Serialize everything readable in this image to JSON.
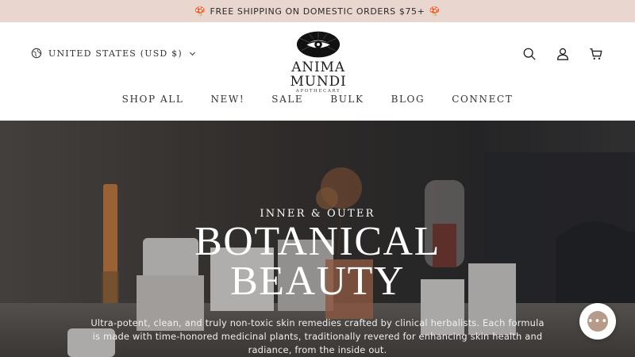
{
  "announcement": {
    "emoji_left": "🍄",
    "text": "FREE SHIPPING ON DOMESTIC ORDERS $75+",
    "emoji_right": "🍄"
  },
  "header": {
    "locale_label": "UNITED STATES (USD $)",
    "logo": {
      "name": "ANIMA MUNDI",
      "subtitle": "APOTHECARY"
    },
    "icons": [
      "search-icon",
      "account-icon",
      "cart-icon"
    ]
  },
  "nav": {
    "items": [
      "SHOP ALL",
      "NEW!",
      "SALE",
      "BULK",
      "BLOG",
      "CONNECT"
    ]
  },
  "hero": {
    "eyebrow": "INNER & OUTER",
    "title_line1": "BOTANICAL",
    "title_line2": "BEAUTY",
    "description": "Ultra-potent, clean, and truly non-toxic skin remedies crafted by clinical herbalists. Each formula is made with time-honored medicinal plants, traditionally revered for enhancing skin health and radiance, from the inside out."
  },
  "chat": {
    "glyph": "•••"
  },
  "colors": {
    "announcement_bg": "#e8d6cf",
    "header_bg": "#ffffff",
    "hero_overlay": "#3a3634"
  }
}
